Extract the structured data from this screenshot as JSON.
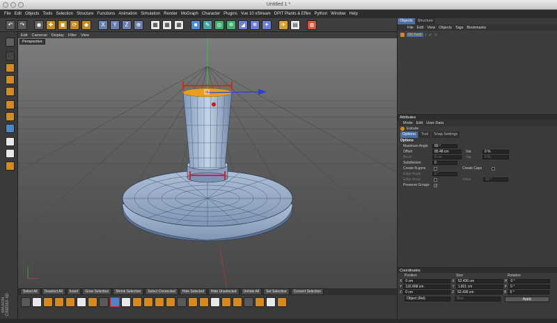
{
  "window_title": "Untitled 1 *",
  "menubar": [
    "File",
    "Edit",
    "Objects",
    "Tools",
    "Selection",
    "Structure",
    "Functions",
    "Animation",
    "Simulation",
    "Render",
    "MoGraph",
    "Character",
    "Plugins",
    "Vue 10 xStream",
    "DPIT Plants & Effex",
    "Python",
    "Window",
    "Help"
  ],
  "viewport": {
    "menu": [
      "Edit",
      "Cameras",
      "Display",
      "Filter",
      "View"
    ],
    "label": "Perspective"
  },
  "selection_toolbar": [
    "Select All",
    "Deselect All",
    "Invert",
    "Grow Selection",
    "Shrink Selection",
    "Select Connected",
    "Hide Selected",
    "Hide Unselected",
    "Unhide All",
    "Set Selection",
    "Convert Selection"
  ],
  "logo": "MAXON CINEMA 4D",
  "objects_panel": {
    "tabs": [
      "Objects",
      "Structure"
    ],
    "menu": [
      "File",
      "Edit",
      "View",
      "Objects",
      "Tags",
      "Bookmarks"
    ],
    "item": "Oil Tank"
  },
  "attributes_panel": {
    "title": "Attributes",
    "menu": [
      "Mode",
      "Edit",
      "User Data"
    ],
    "object": "Extrude",
    "tabs": [
      "Options",
      "Tool",
      "Snap Settings"
    ],
    "section": "Options",
    "max_angle_label": "Maximum Angle",
    "max_angle_value": "89 °",
    "offset_label": "Offset",
    "offset_value": "85.48 cm",
    "var_label": "Var.",
    "var_value": "0 %",
    "bevel_label": "Bevel",
    "bevel_value": "0 cm",
    "var2_value": "0 %",
    "subdivision_label": "Subdivision",
    "subdivision_value": "0",
    "create_ngons_label": "Create N-gons",
    "create_caps_label": "Create Caps",
    "edge_angle_label": "Edge Angle",
    "edge_angle_value": "0 °",
    "edge_snap_label": "Edge Snap",
    "value_label": "Value",
    "value_value": "10 °",
    "preserve_groups_label": "Preserve Groups"
  },
  "coordinates_panel": {
    "title": "Coordinates",
    "headers": [
      "Position",
      "Size",
      "Rotation"
    ],
    "rows": [
      {
        "axis": "X",
        "pos": "0 cm",
        "size_axis": "X",
        "size": "52.436 cm",
        "rot_axis": "H",
        "rot": "0 °"
      },
      {
        "axis": "Y",
        "pos": "132.668 cm",
        "size_axis": "Y",
        "size": "1.821 cm",
        "rot_axis": "P",
        "rot": "0 °"
      },
      {
        "axis": "Z",
        "pos": "0 cm",
        "size_axis": "Z",
        "size": "52.436 cm",
        "rot_axis": "B",
        "rot": "0 °"
      }
    ],
    "mode": "Object (Rel)",
    "size_mode": "Size",
    "apply": "Apply"
  }
}
